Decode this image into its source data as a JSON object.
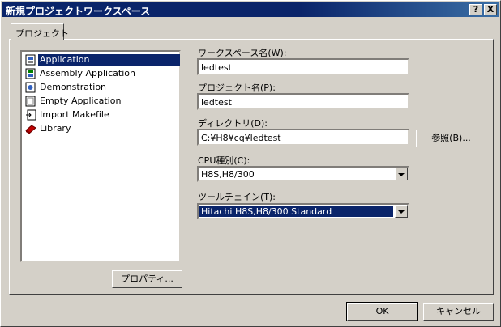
{
  "window": {
    "title": "新規プロジェクトワークスペース",
    "help_btn": "?",
    "close_btn": "X"
  },
  "tabs": [
    {
      "label": "プロジェクト"
    }
  ],
  "project_types": [
    {
      "label": "Application",
      "icon": "application-icon",
      "selected": true
    },
    {
      "label": "Assembly Application",
      "icon": "assembly-icon",
      "selected": false
    },
    {
      "label": "Demonstration",
      "icon": "demonstration-icon",
      "selected": false
    },
    {
      "label": "Empty Application",
      "icon": "empty-app-icon",
      "selected": false
    },
    {
      "label": "Import Makefile",
      "icon": "makefile-icon",
      "selected": false
    },
    {
      "label": "Library",
      "icon": "library-icon",
      "selected": false
    }
  ],
  "fields": {
    "workspace_name": {
      "label": "ワークスペース名(W):",
      "value": "ledtest"
    },
    "project_name": {
      "label": "プロジェクト名(P):",
      "value": "ledtest"
    },
    "directory": {
      "label": "ディレクトリ(D):",
      "value": "C:¥H8¥cq¥ledtest"
    },
    "cpu_type": {
      "label": "CPU種別(C):",
      "value": "H8S,H8/300"
    },
    "toolchain": {
      "label": "ツールチェイン(T):",
      "value": "Hitachi H8S,H8/300 Standard"
    }
  },
  "buttons": {
    "browse": "参照(B)...",
    "properties": "プロパティ...",
    "ok": "OK",
    "cancel": "キャンセル"
  }
}
